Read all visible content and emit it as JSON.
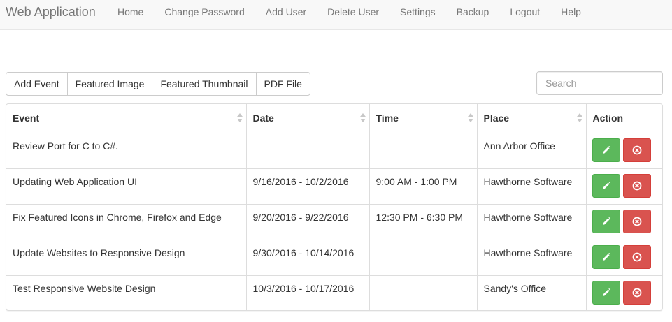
{
  "navbar": {
    "brand": "Web Application",
    "links": [
      "Home",
      "Change Password",
      "Add User",
      "Delete User",
      "Settings",
      "Backup",
      "Logout",
      "Help"
    ]
  },
  "toolbar": {
    "buttons": [
      "Add Event",
      "Featured Image",
      "Featured Thumbnail",
      "PDF File"
    ],
    "search_placeholder": "Search"
  },
  "table": {
    "columns": [
      "Event",
      "Date",
      "Time",
      "Place",
      "Action"
    ],
    "rows": [
      {
        "event": "Review Port for C to C#.",
        "date": "",
        "time": "",
        "place": "Ann Arbor Office"
      },
      {
        "event": "Updating Web Application UI",
        "date": "9/16/2016 - 10/2/2016",
        "time": "9:00 AM - 1:00 PM",
        "place": "Hawthorne Software"
      },
      {
        "event": "Fix Featured Icons in Chrome, Firefox and Edge",
        "date": "9/20/2016 - 9/22/2016",
        "time": "12:30 PM - 6:30 PM",
        "place": "Hawthorne Software"
      },
      {
        "event": "Update Websites to Responsive Design",
        "date": "9/30/2016 - 10/14/2016",
        "time": "",
        "place": "Hawthorne Software"
      },
      {
        "event": "Test Responsive Website Design",
        "date": "10/3/2016 - 10/17/2016",
        "time": "",
        "place": "Sandy's Office"
      }
    ]
  },
  "colors": {
    "edit": "#5cb85c",
    "delete": "#d9534f",
    "navbar": "#f8f8f8"
  },
  "icons": {
    "edit": "pencil-icon",
    "delete": "remove-circle-icon"
  }
}
